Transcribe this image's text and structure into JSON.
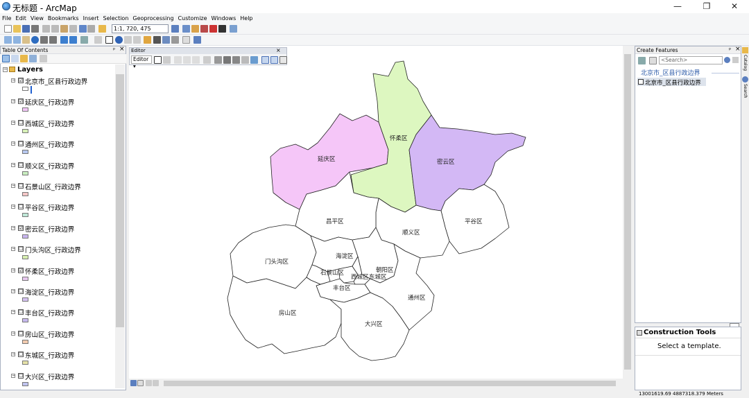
{
  "window": {
    "title": "无标题 - ArcMap",
    "minimize": "—",
    "maximize": "❐",
    "close": "✕"
  },
  "menu": [
    "File",
    "Edit",
    "View",
    "Bookmarks",
    "Insert",
    "Selection",
    "Geoprocessing",
    "Customize",
    "Windows",
    "Help"
  ],
  "toolbar": {
    "scale": "1:1, 720, 475"
  },
  "toc": {
    "title": "Table Of Contents",
    "root": "Layers",
    "layers": [
      {
        "label": "北京市_区县行政边界",
        "checked": "☑",
        "swatch": "#ffffff"
      },
      {
        "label": "延庆区_行政边界",
        "checked": "☑",
        "swatch": "#f3c6f7"
      },
      {
        "label": "西城区_行政边界",
        "checked": "☐",
        "swatch": "#d8f2b8"
      },
      {
        "label": "通州区_行政边界",
        "checked": "☐",
        "swatch": "#b8c9f0"
      },
      {
        "label": "顺义区_行政边界",
        "checked": "☐",
        "swatch": "#c9eec0"
      },
      {
        "label": "石景山区_行政边界",
        "checked": "☐",
        "swatch": "#f6c8c8"
      },
      {
        "label": "平谷区_行政边界",
        "checked": "☐",
        "swatch": "#bfe8d8"
      },
      {
        "label": "密云区_行政边界",
        "checked": "☑",
        "swatch": "#c9b6f0"
      },
      {
        "label": "门头沟区_行政边界",
        "checked": "☐",
        "swatch": "#d8f0b0"
      },
      {
        "label": "怀柔区_行政边界",
        "checked": "☑",
        "swatch": "#e8c8f0"
      },
      {
        "label": "海淀区_行政边界",
        "checked": "☐",
        "swatch": "#d6c2f2"
      },
      {
        "label": "丰台区_行政边界",
        "checked": "☐",
        "swatch": "#c7b9ef"
      },
      {
        "label": "房山区_行政边界",
        "checked": "☐",
        "swatch": "#f3ccb0"
      },
      {
        "label": "东城区_行政边界",
        "checked": "☐",
        "swatch": "#e6e2a8"
      },
      {
        "label": "大兴区_行政边界",
        "checked": "☐",
        "swatch": "#c0c4f0"
      }
    ]
  },
  "editor": {
    "title": "Editor",
    "button": "Editor ▾"
  },
  "map": {
    "districts": [
      "延庆区",
      "怀柔区",
      "密云区",
      "昌平区",
      "顺义区",
      "平谷区",
      "门头沟区",
      "海淀区",
      "朝阳区",
      "石景山区",
      "西城区",
      "东城区",
      "丰台区",
      "通州区",
      "房山区",
      "大兴区"
    ],
    "colors": {
      "yanqing": "#f5c6f8",
      "huairou": "#ddf7c0",
      "miyun": "#d3b8f5",
      "outline": "#222222"
    }
  },
  "create_features": {
    "title": "Create Features",
    "search": "<Search>",
    "group": "北京市_区县行政边界",
    "item": "北京市_区县行政边界"
  },
  "construction_tools": {
    "title": "Construction Tools",
    "hint": "Select a template."
  },
  "status": {
    "coords": "13001619.69  4887318.379 Meters"
  },
  "side_tabs": [
    "Catalog",
    "Search"
  ]
}
